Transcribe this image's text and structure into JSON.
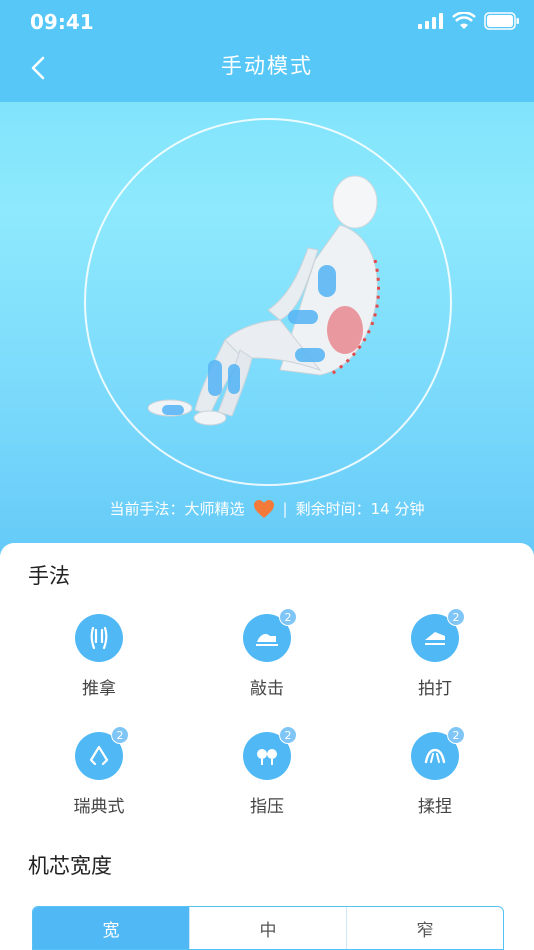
{
  "status": {
    "time": "09:41"
  },
  "nav": {
    "title": "手动模式"
  },
  "info": {
    "technique_label": "当前手法：大师精选",
    "divider": "|",
    "remaining_label": "剩余时间：14 分钟"
  },
  "techniques_section": {
    "title": "手法",
    "items": [
      {
        "label": "推拿",
        "icon": "hands-icon",
        "badge": ""
      },
      {
        "label": "敲击",
        "icon": "knock-icon",
        "badge": "2"
      },
      {
        "label": "拍打",
        "icon": "pat-icon",
        "badge": "2"
      },
      {
        "label": "瑞典式",
        "icon": "swedish-icon",
        "badge": "2"
      },
      {
        "label": "指压",
        "icon": "finger-press-icon",
        "badge": "2"
      },
      {
        "label": "揉捏",
        "icon": "knead-icon",
        "badge": "2"
      }
    ]
  },
  "width_section": {
    "title": "机芯宽度",
    "options": [
      "宽",
      "中",
      "窄"
    ],
    "selected": "宽"
  },
  "colors": {
    "primary": "#4fb8f5",
    "heart": "#f47a3a",
    "header": "#56c7f6"
  }
}
